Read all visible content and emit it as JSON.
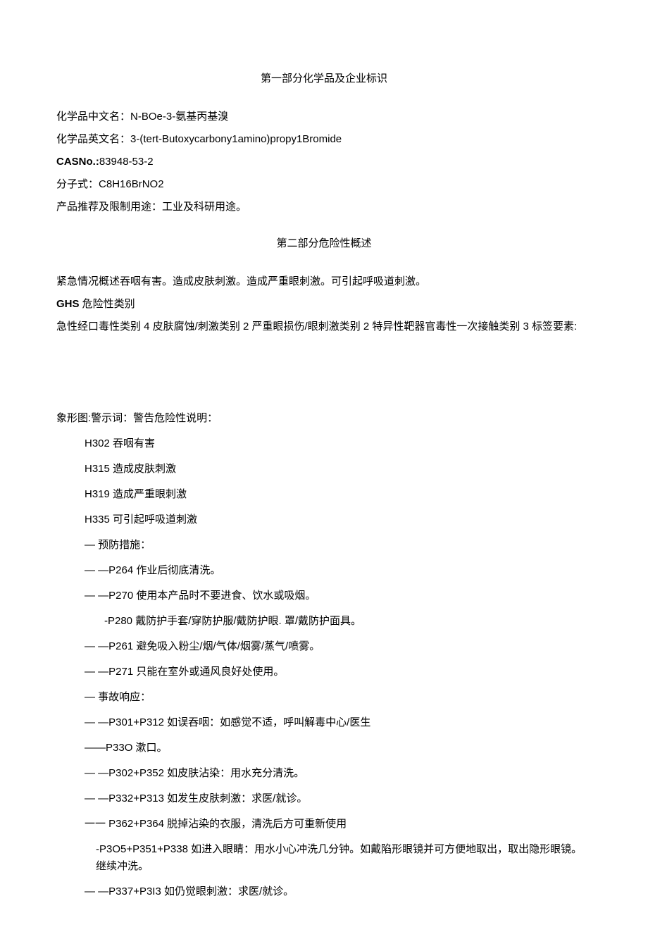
{
  "section1": {
    "title": "第一部分化学品及企业标识",
    "chinese_name_label": "化学品中文名：",
    "chinese_name": "N-BOe-3-氨基丙基溴",
    "english_name_label": "化学品英文名：",
    "english_name": "3-(tert-Butoxycarbony1amino)propy1Bromide",
    "cas_label": "CASNo.:",
    "cas_no": "83948-53-2",
    "formula_label": "分子式：",
    "formula": "C8H16BrNO2",
    "use_label": "产品推荐及限制用途：",
    "use": "工业及科研用途。"
  },
  "section2": {
    "title": "第二部分危险性概述",
    "emergency": "紧急情况概述吞咽有害。造成皮肤刺激。造成严重眼刺激。可引起呼吸道刺激。",
    "ghs_label": "GHS",
    "ghs_label2": " 危险性类别",
    "classification": "急性经口毒性类别 4 皮肤腐蚀/刺激类别 2 严重眼损伤/眼刺激类别 2 特异性靶器官毒性一次接触类别 3 标签要素:",
    "pictogram_line": "象形图:警示词：警告危险性说明：",
    "h302": "H302 吞咽有害",
    "h315": "H315 造成皮肤刺激",
    "h319": "H319 造成严重眼刺激",
    "h335": "H335 可引起呼吸道刺激",
    "prevention_head": "— 预防措施：",
    "p264": "—   —P264 作业后彻底清洗。",
    "p270": "—   —P270 使用本产品时不要进食、饮水或吸烟。",
    "p280": "-P280 戴防护手套/穿防护服/戴防护眼. 罩/戴防护面具。",
    "p261": "—   —P261 避免吸入粉尘/烟/气体/烟雾/蒸气/喷雾。",
    "p271": "—   —P271 只能在室外或通风良好处使用。",
    "response_head": "— 事故响应：",
    "p301": "—   —P301+P312 如误吞咽：如感觉不适，呼叫解毒中心/医生",
    "p330": "——P33O 漱口。",
    "p302": "—   —P302+P352 如皮肤沾染：用水充分清洗。",
    "p332": "—   —P332+P313 如发生皮肤刺激：求医/就诊。",
    "p362": "一一 P362+P364 脱掉沾染的衣服，清洗后方可重新使用",
    "p305": "-P3O5+P351+P338 如进入眼睛：用水小心冲洗几分钟。如戴陷形眼镜并可方便地取出，取出隐形眼镜。继续冲洗。",
    "p337": "—           —P337+P3I3 如仍觉眼刺激：求医/就诊。"
  }
}
